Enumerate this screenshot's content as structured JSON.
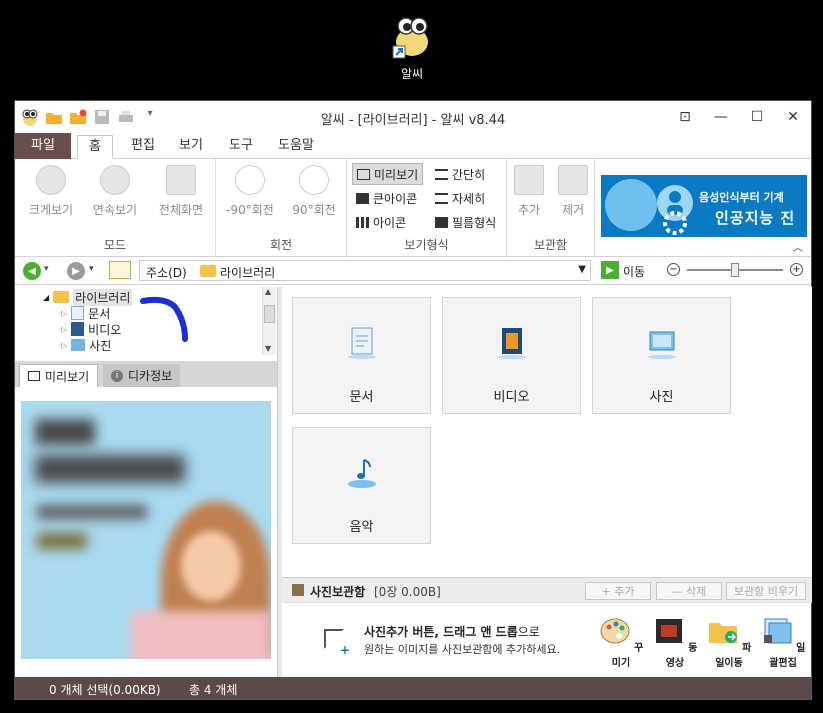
{
  "desktop": {
    "icon_label": "알씨"
  },
  "window": {
    "title": "알씨 - [라이브러리] - 알씨 v8.44",
    "menu_tabs": [
      "파일",
      "홈",
      "편집",
      "보기",
      "도구",
      "도움말"
    ]
  },
  "ribbon": {
    "mode": {
      "label": "모드",
      "buttons": [
        "크게보기",
        "연속보기",
        "전체화면"
      ]
    },
    "rotate": {
      "label": "회전",
      "buttons": [
        "-90°회전",
        "90°회전"
      ]
    },
    "view_type": {
      "label": "보기형식",
      "options": [
        "미리보기",
        "간단히",
        "큰아이콘",
        "자세히",
        "아이콘",
        "필름형식"
      ],
      "selected": "미리보기"
    },
    "album": {
      "label": "보관함",
      "buttons": [
        "추가",
        "제거"
      ]
    },
    "banner": {
      "line1": "음성인식부터 기계",
      "line2": "인공지능 진"
    }
  },
  "address": {
    "label": "주소(D)",
    "value": "라이브러리",
    "go": "이동"
  },
  "tree": {
    "items": [
      "라이브러리",
      "문서",
      "비디오",
      "사진"
    ]
  },
  "preview": {
    "tabs": [
      "미리보기",
      "디카정보"
    ]
  },
  "library": {
    "tiles": [
      "문서",
      "비디오",
      "사진",
      "음악"
    ]
  },
  "album_panel": {
    "title": "사진보관함",
    "count": "[0장 0.00B]",
    "buttons": [
      "+ 추가",
      "— 삭제",
      "보관함 비우기"
    ],
    "hint_bold": "사진추가 버튼, 드래그 앤 드롭",
    "hint_suffix": "으로",
    "hint_line2": "원하는 이미지를 사진보관함에 추가하세요.",
    "tools": [
      "꾸미기",
      "동영상",
      "파일이동",
      "일괄편집"
    ]
  },
  "status": {
    "selected": "0 개체 선택(0.00KB)",
    "total": "총 4 개체"
  },
  "colors": {
    "accent": "#6b4d4a",
    "status_bar": "#5c4a48",
    "banner": "#0a7ac2",
    "ink": "#1a2fd6"
  }
}
